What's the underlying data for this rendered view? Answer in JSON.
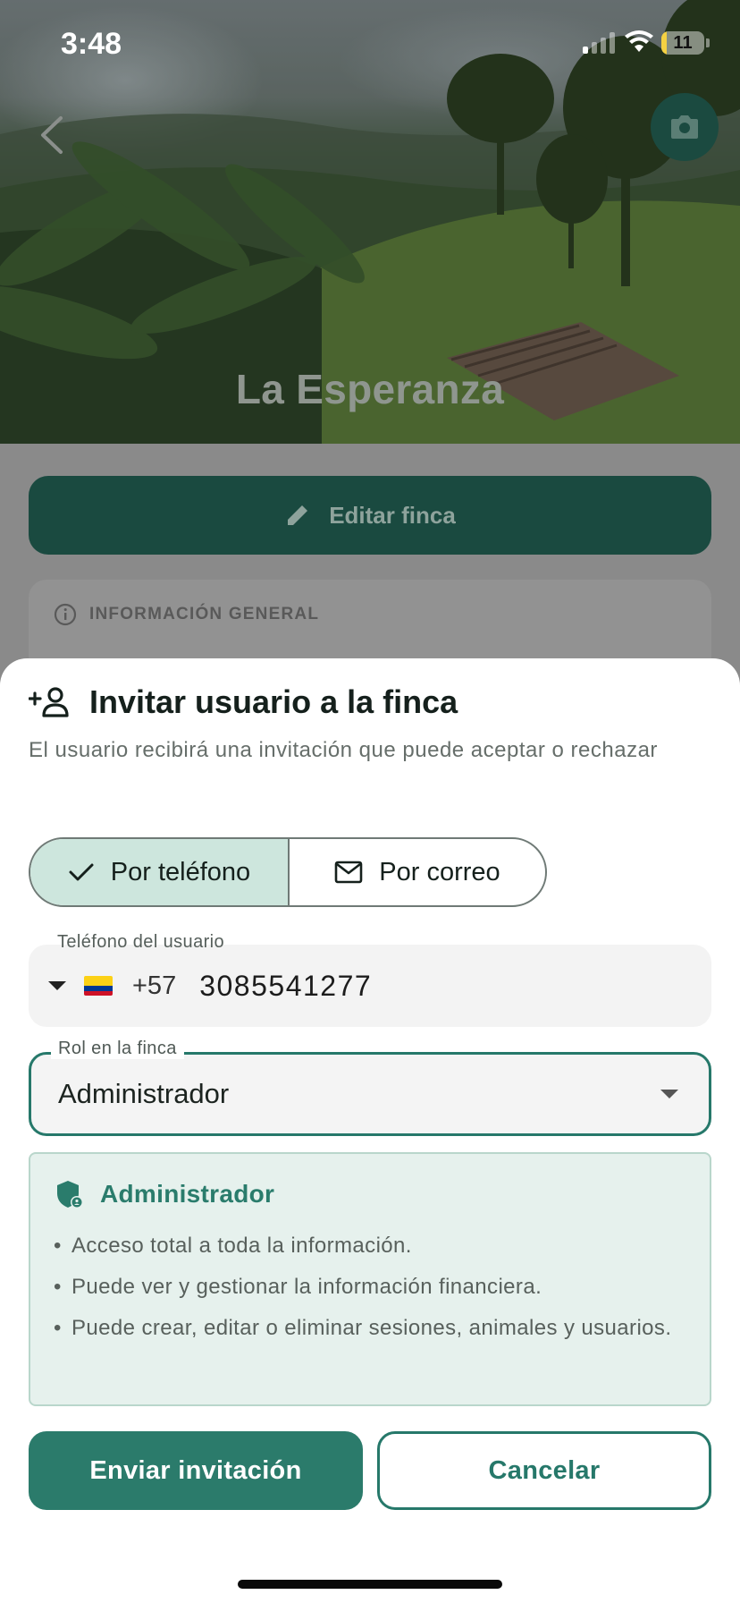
{
  "status_bar": {
    "time": "3:48",
    "battery": "11"
  },
  "header": {
    "farm_name": "La Esperanza",
    "back_icon": "chevron-left-icon",
    "camera_icon": "camera-icon"
  },
  "background": {
    "edit_button_label": "Editar finca",
    "info_section_title": "INFORMACIÓN GENERAL"
  },
  "sheet": {
    "title": "Invitar usuario a la finca",
    "subtitle": "El usuario recibirá una invitación que puede aceptar o rechazar",
    "method_tabs": [
      {
        "label": "Por teléfono",
        "icon": "check-icon",
        "selected": true
      },
      {
        "label": "Por correo",
        "icon": "mail-icon",
        "selected": false
      }
    ],
    "phone": {
      "label": "Teléfono del usuario",
      "country_code": "+57",
      "number": "3085541277",
      "country": "Colombia"
    },
    "role": {
      "label": "Rol en la finca",
      "value": "Administrador"
    },
    "role_info": {
      "title": "Administrador",
      "permissions": [
        "Acceso total a toda la información.",
        "Puede ver y gestionar la información financiera.",
        "Puede crear, editar o eliminar sesiones, animales y usuarios."
      ]
    },
    "send_label": "Enviar invitación",
    "cancel_label": "Cancelar"
  },
  "colors": {
    "primary": "#2b7b6b",
    "primary_dark": "#1a4a40",
    "selected_tab": "#cde6dd",
    "info_bg": "#e6f1ed"
  }
}
